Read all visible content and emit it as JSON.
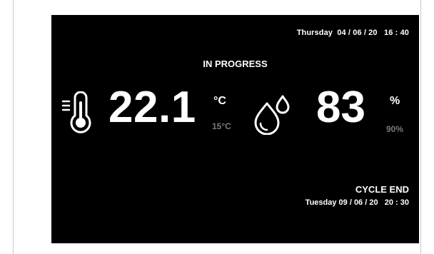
{
  "header": {
    "datetime": "Thursday  04 / 06 / 20   16 : 40"
  },
  "status": {
    "label": "IN PROGRESS"
  },
  "temperature": {
    "icon": "thermometer-icon",
    "value": "22.1",
    "unit": "°C",
    "target": "15°C"
  },
  "humidity": {
    "icon": "water-drops-icon",
    "value": "83",
    "unit": "%",
    "target": "90%"
  },
  "cycle_end": {
    "label": "CYCLE END",
    "datetime": "Tuesday 09 / 06 / 20   20 : 30"
  },
  "colors": {
    "screen_background": "#000000",
    "primary_text": "#ffffff",
    "target_text": "#7a7a7a"
  }
}
